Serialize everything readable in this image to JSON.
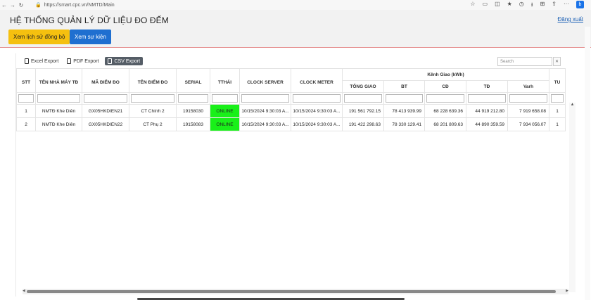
{
  "browser": {
    "url": "https://smart.cpc.vn/NMTD/Main"
  },
  "header": {
    "title": "HỆ THỐNG QUẢN LÝ DỮ LIỆU ĐO ĐẾM",
    "logout_label": "Đăng xuất"
  },
  "actions": {
    "sync_history_label": "Xem lịch sử đồng bộ",
    "events_label": "Xem sự kiện"
  },
  "toolbar": {
    "excel_label": "Excel Export",
    "pdf_label": "PDF Export",
    "csv_label": "CSV Export",
    "search_placeholder": "Search"
  },
  "table": {
    "group_header": "Kênh Giao (kWh)",
    "columns": [
      "STT",
      "TÊN NHÀ MÁY TĐ",
      "MÃ ĐIỂM ĐO",
      "TÊN ĐIỂM ĐO",
      "SERIAL",
      "TTHÁI",
      "CLOCK SERVER",
      "CLOCK METER",
      "TỔNG GIAO",
      "BT",
      "CĐ",
      "TĐ",
      "Varh",
      "TU"
    ],
    "rows": [
      [
        "1",
        "NMTĐ Khe Diên",
        "GX05HKDIEN21",
        "CT Chính 2",
        "19158030",
        "ONLINE",
        "10/15/2024 9:30:03 A...",
        "10/15/2024 9:30:03 A...",
        "191 561 792.15",
        "78 413 939.99",
        "68 228 639.36",
        "44 919 212.80",
        "7 919 658.08",
        "1"
      ],
      [
        "2",
        "NMTĐ Khe Diên",
        "GX05HKDIEN22",
        "CT Phụ 2",
        "19158083",
        "ONLINE",
        "10/15/2024 9:30:03 A...",
        "10/15/2024 9:30:03 A...",
        "191 422 298.63",
        "78 330 129.41",
        "68 201 809.63",
        "44 890 359.59",
        "7 934 056.07",
        "1"
      ]
    ]
  },
  "colors": {
    "online": "#19f019",
    "sync_button": "#f5c00f",
    "events_button": "#1f6fd0"
  }
}
